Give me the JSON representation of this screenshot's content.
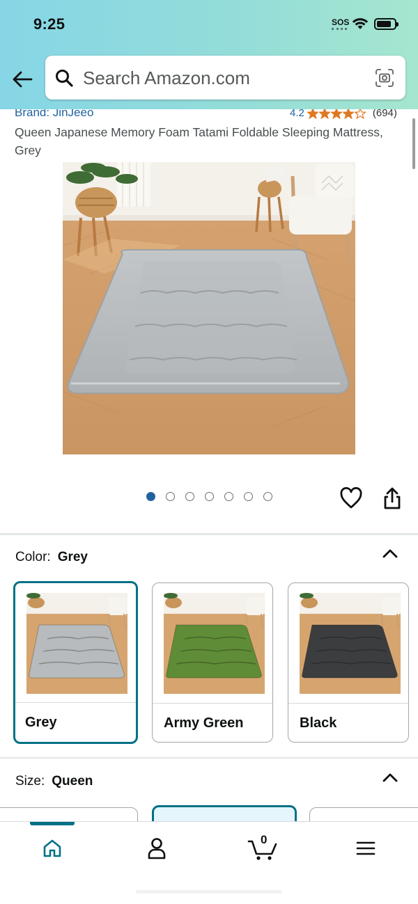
{
  "status_bar": {
    "time": "9:25",
    "sos": "SOS"
  },
  "search": {
    "placeholder": "Search Amazon.com"
  },
  "product": {
    "brand": "Brand: JinJeeo",
    "rating": "4.2",
    "rating_stars": 4.2,
    "rating_count": "(694)",
    "title": "Queen Japanese Memory Foam Tatami Foldable Sleeping Mattress, Grey",
    "image_count": 7,
    "active_image": 1
  },
  "color_section": {
    "label": "Color:",
    "selected": "Grey",
    "options": [
      {
        "name": "Grey",
        "swatch": "#b7bbbd",
        "selected": true
      },
      {
        "name": "Army Green",
        "swatch": "#5f8c36",
        "selected": false
      },
      {
        "name": "Black",
        "swatch": "#3b3d3f",
        "selected": false
      }
    ]
  },
  "size_section": {
    "label": "Size:",
    "selected": "Queen"
  },
  "bottom_nav": {
    "items": [
      "home-icon",
      "account-icon",
      "cart-icon",
      "menu-icon"
    ],
    "cart_count": "0",
    "active": "home"
  },
  "colors": {
    "accent_teal": "#007185",
    "link_blue": "#2162a1",
    "star_orange": "#de7921"
  }
}
